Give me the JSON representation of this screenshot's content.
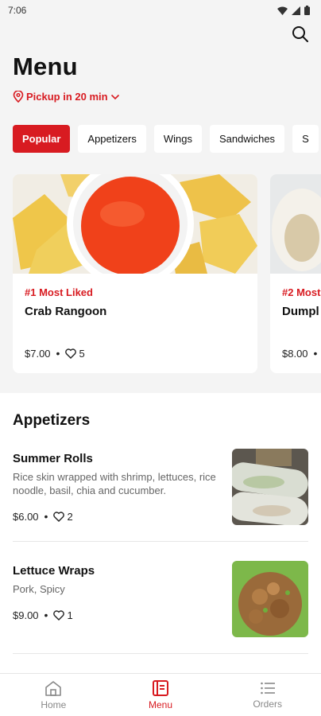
{
  "status": {
    "time": "7:06"
  },
  "header": {
    "title": "Menu",
    "pickup": "Pickup in 20 min"
  },
  "categories": [
    "Popular",
    "Appetizers",
    "Wings",
    "Sandwiches",
    "S"
  ],
  "featured": [
    {
      "badge": "#1 Most Liked",
      "name": "Crab Rangoon",
      "price": "$7.00",
      "likes": "5"
    },
    {
      "badge": "#2 Most",
      "name": "Dumpl",
      "price": "$8.00",
      "likes": ""
    }
  ],
  "section": {
    "title": "Appetizers",
    "items": [
      {
        "name": "Summer Rolls",
        "desc": "Rice skin wrapped with shrimp, lettuces, rice noodle, basil, chia and cucumber.",
        "price": "$6.00",
        "likes": "2"
      },
      {
        "name": "Lettuce Wraps",
        "desc": "Pork, Spicy",
        "price": "$9.00",
        "likes": "1"
      }
    ]
  },
  "bottom_nav": {
    "home": "Home",
    "menu": "Menu",
    "orders": "Orders"
  },
  "colors": {
    "accent": "#d81b21",
    "background": "#f4f4f4"
  }
}
